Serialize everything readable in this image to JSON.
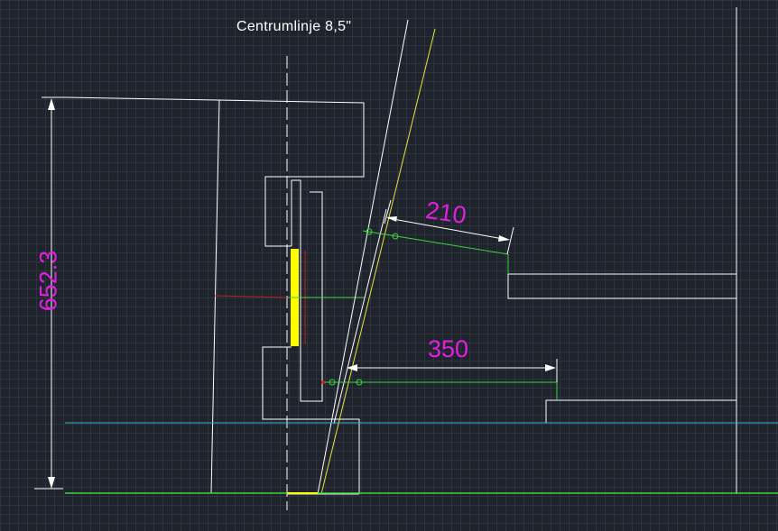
{
  "drawing": {
    "title": "Centrumlinje 8,5\"",
    "dimensions": {
      "upper_offset": "210",
      "lower_offset": "350",
      "height": "652.3"
    }
  },
  "colors": {
    "background": "#1f232c",
    "outline": "#ffffff",
    "dimension_text": "#e020e0",
    "ground_line": "#3fd13f",
    "cyan_line": "#2fb6c8",
    "yellow_part": "#ffff00"
  }
}
